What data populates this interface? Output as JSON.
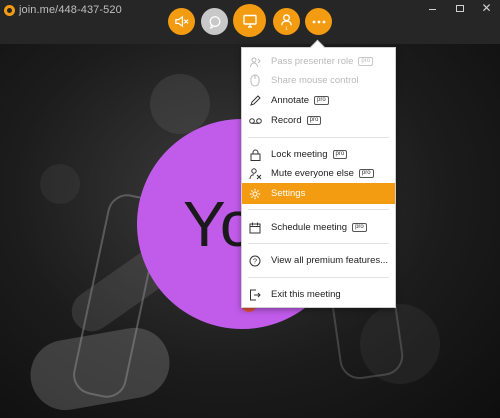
{
  "app": {
    "brand": "join.me",
    "meeting_id": "/448-437-520"
  },
  "window": {
    "min_icon": "minimize-icon",
    "max_icon": "maximize-icon",
    "close_glyph": "✕"
  },
  "toolbar": {
    "buttons": [
      {
        "name": "mute-audio",
        "icon": "speaker-muted-icon"
      },
      {
        "name": "chat",
        "icon": "chat-bubble-icon"
      },
      {
        "name": "screen-share",
        "icon": "monitor-icon"
      },
      {
        "name": "participants",
        "icon": "person-icon",
        "badge": "1"
      },
      {
        "name": "more",
        "icon": "ellipsis-icon"
      }
    ]
  },
  "stage": {
    "avatar_text": "Yo"
  },
  "menu": {
    "pro_label": "pro",
    "items": [
      {
        "label": "Pass presenter role",
        "pro": true,
        "disabled": true,
        "icon": "presenter-icon"
      },
      {
        "label": "Share mouse control",
        "pro": false,
        "disabled": true,
        "icon": "mouse-icon"
      },
      {
        "label": "Annotate",
        "pro": true,
        "disabled": false,
        "icon": "pencil-icon"
      },
      {
        "label": "Record",
        "pro": true,
        "disabled": false,
        "icon": "record-tape-icon"
      },
      {
        "label": "Lock meeting",
        "pro": true,
        "disabled": false,
        "icon": "lock-icon"
      },
      {
        "label": "Mute everyone else",
        "pro": true,
        "disabled": false,
        "icon": "mute-person-icon"
      },
      {
        "label": "Settings",
        "pro": false,
        "disabled": false,
        "active": true,
        "icon": "gear-icon"
      },
      {
        "label": "Schedule meeting",
        "pro": true,
        "disabled": false,
        "icon": "calendar-icon"
      },
      {
        "label": "View all premium features...",
        "pro": false,
        "disabled": false,
        "icon": "help-icon"
      },
      {
        "label": "Exit this meeting",
        "pro": false,
        "disabled": false,
        "icon": "exit-icon"
      }
    ]
  },
  "colors": {
    "accent": "#f39c12",
    "avatar": "#c15bea",
    "topbar": "#262626"
  }
}
